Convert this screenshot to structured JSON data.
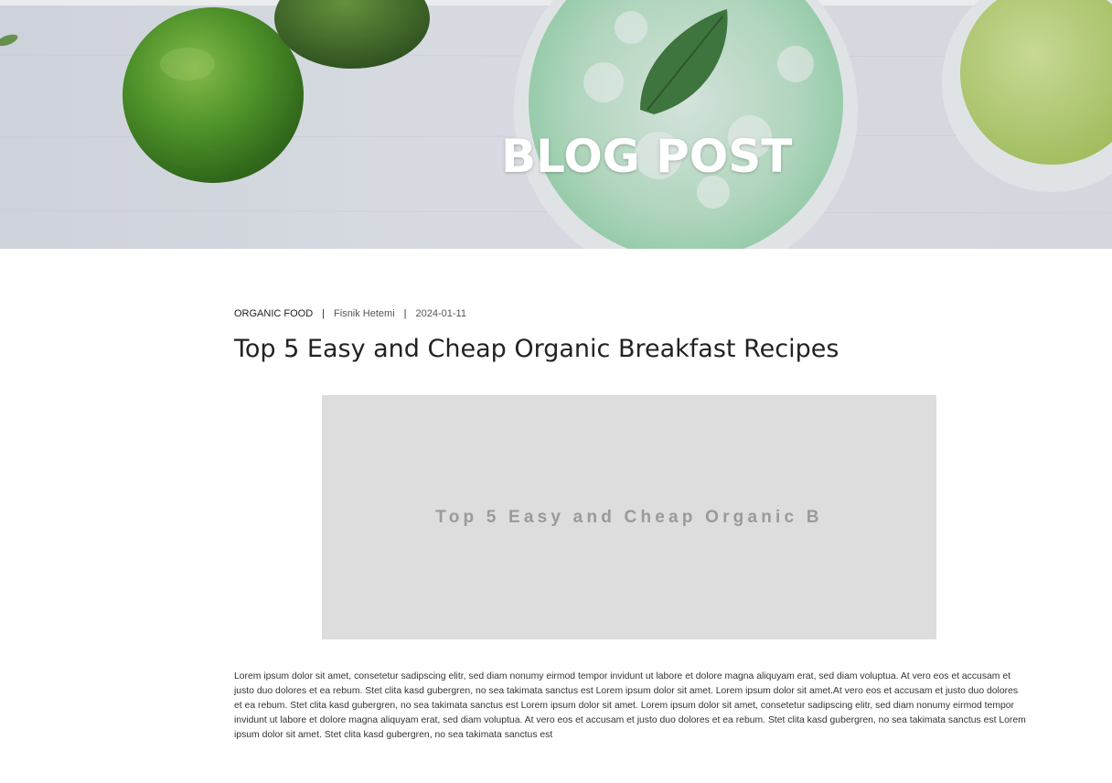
{
  "hero": {
    "title": "BLOG POST"
  },
  "post": {
    "category": "ORGANIC FOOD",
    "author": "Fisnik Hetemi",
    "date": "2024-01-11",
    "separator": "|",
    "title": "Top 5 Easy and Cheap Organic Breakfast Recipes",
    "image_placeholder_text": "Top 5 Easy and Cheap Organic B",
    "body": "Lorem ipsum dolor sit amet, consetetur sadipscing elitr, sed diam nonumy eirmod tempor invidunt ut labore et dolore magna aliquyam erat, sed diam voluptua. At vero eos et accusam et justo duo dolores et ea rebum. Stet clita kasd gubergren, no sea takimata sanctus est Lorem ipsum dolor sit amet. Lorem ipsum dolor sit amet.At vero eos et accusam et justo duo dolores et ea rebum. Stet clita kasd gubergren, no sea takimata sanctus est Lorem ipsum dolor sit amet. Lorem ipsum dolor sit amet, consetetur sadipscing elitr, sed diam nonumy eirmod tempor invidunt ut labore et dolore magna aliquyam erat, sed diam voluptua. At vero eos et accusam et justo duo dolores et ea rebum. Stet clita kasd gubergren, no sea takimata sanctus est Lorem ipsum dolor sit amet. Stet clita kasd gubergren, no sea takimata sanctus est"
  },
  "colors": {
    "placeholder_bg": "#dddddd",
    "placeholder_text": "#9a9a9a",
    "hero_title": "#ffffff"
  }
}
